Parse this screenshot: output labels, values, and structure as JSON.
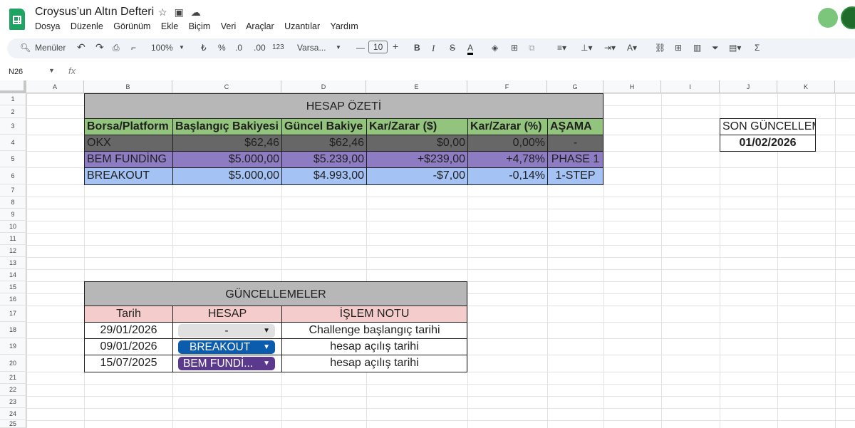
{
  "header": {
    "title": "Croysus’un Altın Defteri",
    "menu": [
      "Dosya",
      "Düzenle",
      "Görünüm",
      "Ekle",
      "Biçim",
      "Veri",
      "Araçlar",
      "Uzantılar",
      "Yardım"
    ]
  },
  "toolbar": {
    "search_label": "Menüler",
    "zoom": "100%",
    "currency": "₺",
    "percent": "%",
    "dec_less": ".0",
    "dec_more": ".00",
    "number_format": "123",
    "font": "Varsa...",
    "font_size": "10"
  },
  "formula_bar": {
    "name_box": "N26",
    "fx": "fx"
  },
  "columns": [
    "A",
    "B",
    "C",
    "D",
    "E",
    "F",
    "G",
    "H",
    "I",
    "J",
    "K"
  ],
  "rows": [
    "1",
    "2",
    "3",
    "4",
    "5",
    "6",
    "7",
    "8",
    "9",
    "10",
    "11",
    "12",
    "13",
    "14",
    "15",
    "16",
    "17",
    "18",
    "19",
    "20",
    "21",
    "22",
    "23",
    "24",
    "25"
  ],
  "summary": {
    "title": "HESAP ÖZETİ",
    "headers": [
      "Borsa/Platform",
      "Başlangıç Bakiyesi",
      "Güncel Bakiye",
      "Kar/Zarar ($)",
      "Kar/Zarar (%)",
      "AŞAMA"
    ],
    "rows": [
      [
        "OKX",
        "$62,46",
        "$62,46",
        "$0,00",
        "0,00%",
        "-"
      ],
      [
        "BEM FUNDİNG",
        "$5.000,00",
        "$5.239,00",
        "+$239,00",
        "+4,78%",
        "PHASE 1"
      ],
      [
        "BREAKOUT",
        "$5.000,00",
        "$4.993,00",
        "-$7,00",
        "-0,14%",
        "1-STEP"
      ]
    ],
    "row_colors": [
      "#676767",
      "#8e7cc3",
      "#a4c2f4"
    ],
    "header_color": "#93c47d",
    "title_color": "#b7b7b7"
  },
  "last_update": {
    "label": "SON GÜNCELLEME",
    "value": "01/02/2026"
  },
  "updates": {
    "title": "GÜNCELLEMELER",
    "headers": [
      "Tarih",
      "HESAP",
      "İŞLEM NOTU"
    ],
    "header_color": "#f4cccc",
    "rows": [
      {
        "date": "29/01/2026",
        "account": "-",
        "note": "Challenge başlangıç tarihi",
        "chip_color": "#e0e0e0",
        "chip_text": "#1f1f1f"
      },
      {
        "date": "09/01/2026",
        "account": "BREAKOUT",
        "note": "hesap açılış tarihi",
        "chip_color": "#0b5cad",
        "chip_text": "#ffffff"
      },
      {
        "date": "15/07/2025",
        "account": "BEM FUNDİ...",
        "note": "hesap açılış tarihi",
        "chip_color": "#5b3a8e",
        "chip_text": "#ffffff"
      }
    ]
  }
}
